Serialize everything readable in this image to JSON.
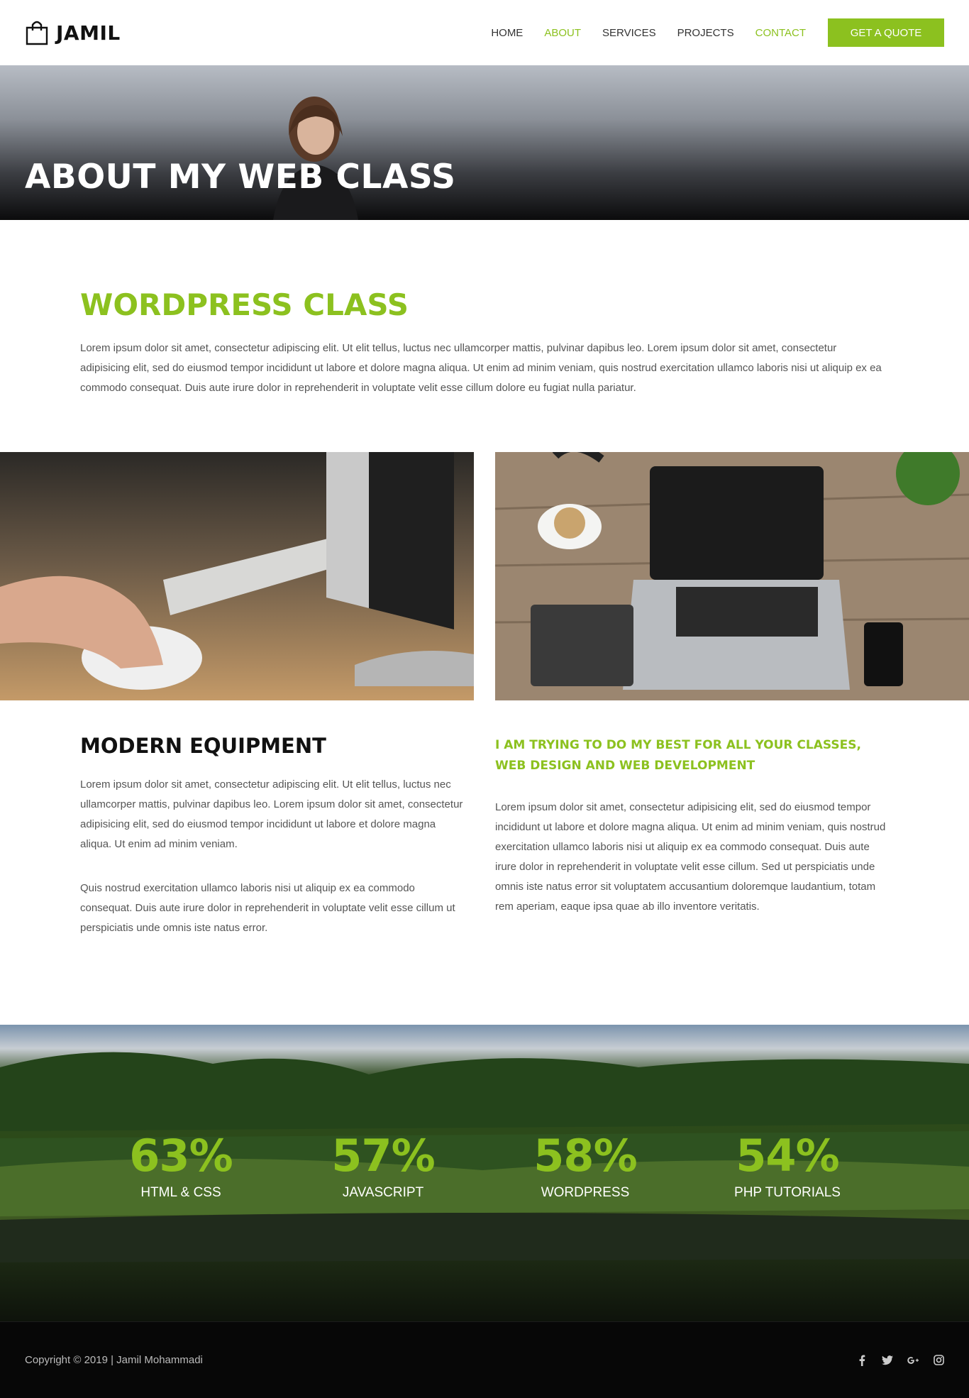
{
  "header": {
    "logo_text": "JAMIL",
    "nav": [
      "HOME",
      "ABOUT",
      "SERVICES",
      "PROJECTS",
      "CONTACT"
    ],
    "quote_button": "GET A QUOTE"
  },
  "hero": {
    "title": "ABOUT MY WEB CLASS"
  },
  "intro": {
    "heading": "WORDPRESS CLASS",
    "text": "Lorem ipsum dolor sit amet, consectetur adipiscing elit. Ut elit tellus, luctus nec ullamcorper mattis, pulvinar dapibus leo. Lorem ipsum dolor sit amet, consectetur adipisicing elit, sed do eiusmod tempor incididunt ut labore et dolore magna aliqua. Ut enim ad minim veniam, quis nostrud exercitation ullamco laboris nisi ut aliquip ex ea commodo consequat. Duis aute irure dolor in reprehenderit in voluptate velit esse cillum dolore eu fugiat nulla pariatur."
  },
  "features": {
    "left": {
      "title": "MODERN EQUIPMENT",
      "p1": "Lorem ipsum dolor sit amet, consectetur adipiscing elit. Ut elit tellus, luctus nec ullamcorper mattis, pulvinar dapibus leo. Lorem ipsum dolor sit amet, consectetur adipisicing elit, sed do eiusmod tempor incididunt ut labore et dolore magna aliqua. Ut enim ad minim veniam.",
      "p2": "Quis nostrud exercitation ullamco laboris nisi ut aliquip ex ea commodo consequat. Duis aute irure dolor in reprehenderit in voluptate velit esse cillum ut perspiciatis unde omnis iste natus error."
    },
    "right": {
      "title": "I AM TRYING TO DO MY BEST FOR ALL YOUR CLASSES, WEB DESIGN AND WEB DEVELOPMENT",
      "text": "Lorem ipsum dolor sit amet, consectetur adipisicing elit, sed do eiusmod tempor incididunt ut labore et dolore magna aliqua. Ut enim ad minim veniam, quis nostrud exercitation ullamco laboris nisi ut aliquip ex ea commodo consequat. Duis aute irure dolor in reprehenderit in voluptate velit esse cillum. Sed ut perspiciatis unde omnis iste natus error sit voluptatem accusantium doloremque laudantium, totam rem aperiam, eaque ipsa quae ab illo inventore veritatis."
    }
  },
  "stats": [
    {
      "value": "63%",
      "label": "HTML & CSS"
    },
    {
      "value": "57%",
      "label": "JAVASCRIPT"
    },
    {
      "value": "58%",
      "label": "WORDPRESS"
    },
    {
      "value": "54%",
      "label": "PHP TUTORIALS"
    }
  ],
  "footer": {
    "copyright": "Copyright © 2019 | Jamil Mohammadi",
    "social_icons": [
      "facebook-icon",
      "twitter-icon",
      "google-plus-icon",
      "instagram-icon"
    ]
  },
  "colors": {
    "accent": "#8cc11f",
    "footer_bg": "#070707"
  }
}
